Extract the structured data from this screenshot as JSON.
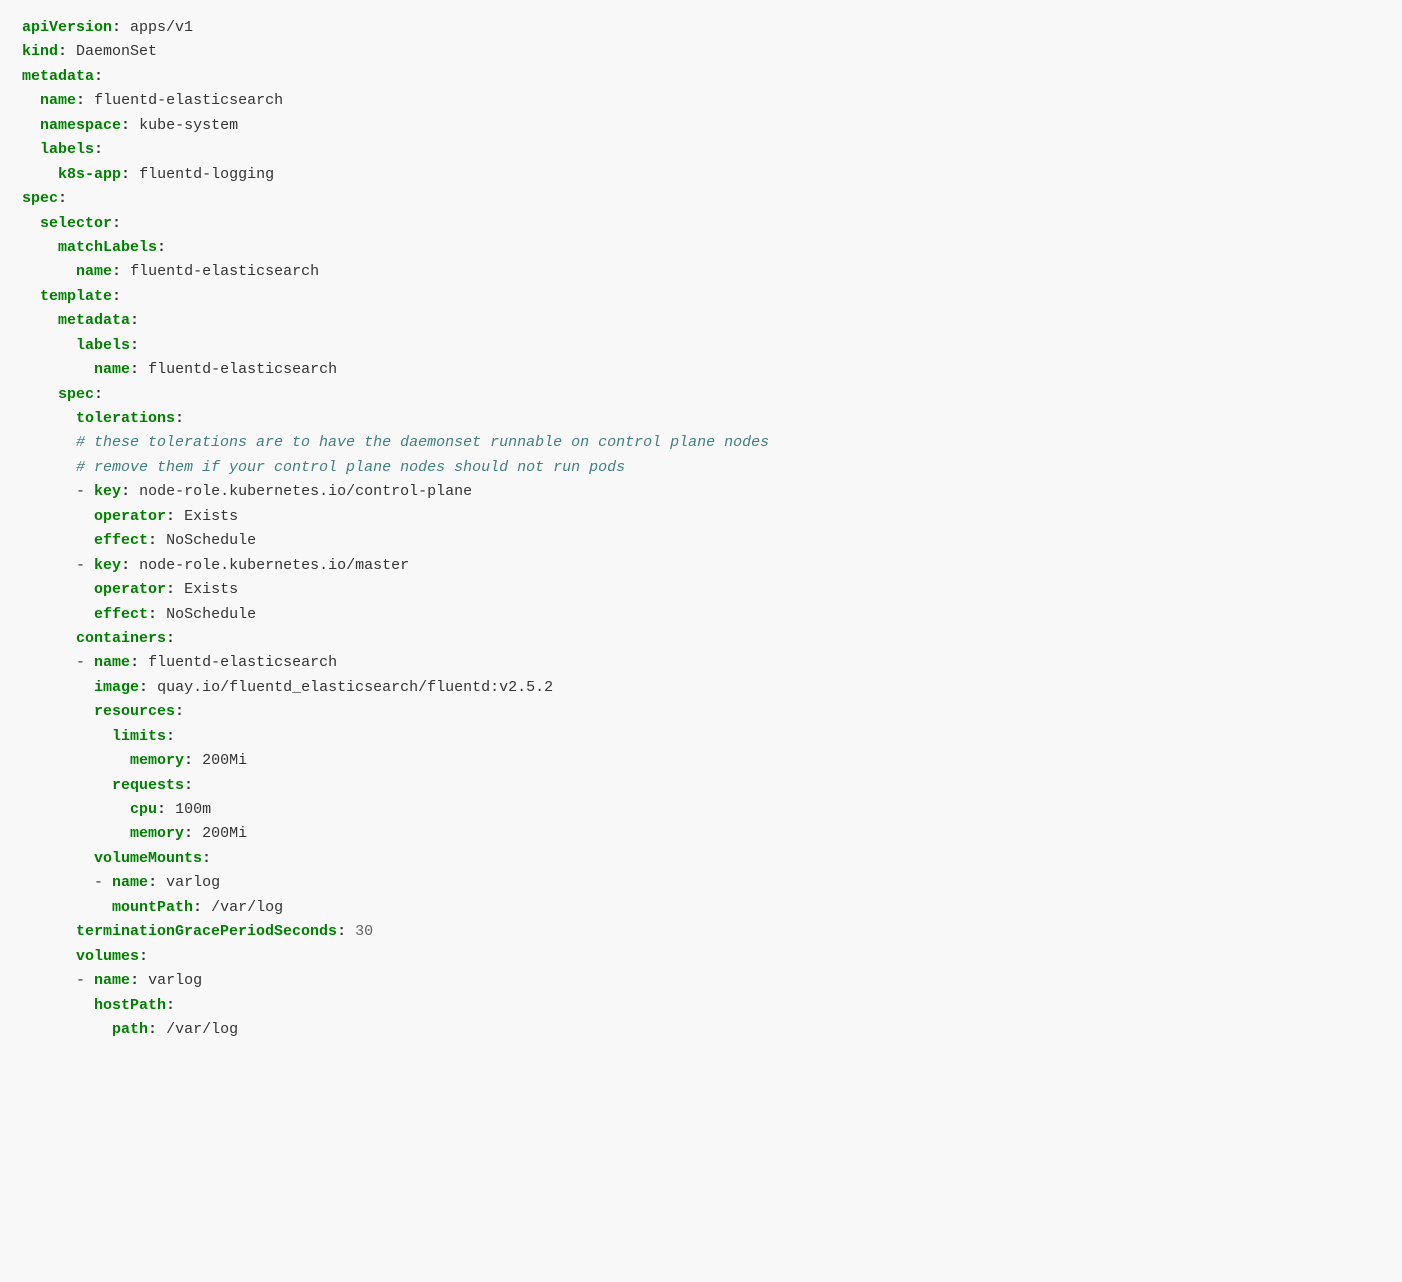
{
  "yaml": {
    "apiVersion": {
      "key": "apiVersion",
      "value": "apps/v1"
    },
    "kind": {
      "key": "kind",
      "value": "DaemonSet"
    },
    "metadata": {
      "key": "metadata",
      "name": {
        "key": "name",
        "value": "fluentd-elasticsearch"
      },
      "namespace": {
        "key": "namespace",
        "value": "kube-system"
      },
      "labels": {
        "key": "labels",
        "k8s_app": {
          "key": "k8s-app",
          "value": "fluentd-logging"
        }
      }
    },
    "spec": {
      "key": "spec",
      "selector": {
        "key": "selector",
        "matchLabels": {
          "key": "matchLabels",
          "name": {
            "key": "name",
            "value": "fluentd-elasticsearch"
          }
        }
      },
      "template": {
        "key": "template",
        "metadata": {
          "key": "metadata",
          "labels": {
            "key": "labels",
            "name": {
              "key": "name",
              "value": "fluentd-elasticsearch"
            }
          }
        },
        "spec": {
          "key": "spec",
          "tolerations": {
            "key": "tolerations",
            "comment1": "# these tolerations are to have the daemonset runnable on control plane nodes",
            "comment2": "# remove them if your control plane nodes should not run pods",
            "items": [
              {
                "key": {
                  "key": "key",
                  "value": "node-role.kubernetes.io/control-plane"
                },
                "operator": {
                  "key": "operator",
                  "value": "Exists"
                },
                "effect": {
                  "key": "effect",
                  "value": "NoSchedule"
                }
              },
              {
                "key": {
                  "key": "key",
                  "value": "node-role.kubernetes.io/master"
                },
                "operator": {
                  "key": "operator",
                  "value": "Exists"
                },
                "effect": {
                  "key": "effect",
                  "value": "NoSchedule"
                }
              }
            ]
          },
          "containers": {
            "key": "containers",
            "items": [
              {
                "name": {
                  "key": "name",
                  "value": "fluentd-elasticsearch"
                },
                "image": {
                  "key": "image",
                  "value": "quay.io/fluentd_elasticsearch/fluentd:v2.5.2"
                },
                "resources": {
                  "key": "resources",
                  "limits": {
                    "key": "limits",
                    "memory": {
                      "key": "memory",
                      "value": "200Mi"
                    }
                  },
                  "requests": {
                    "key": "requests",
                    "cpu": {
                      "key": "cpu",
                      "value": "100m"
                    },
                    "memory": {
                      "key": "memory",
                      "value": "200Mi"
                    }
                  }
                },
                "volumeMounts": {
                  "key": "volumeMounts",
                  "items": [
                    {
                      "name": {
                        "key": "name",
                        "value": "varlog"
                      },
                      "mountPath": {
                        "key": "mountPath",
                        "value": "/var/log"
                      }
                    }
                  ]
                }
              }
            ]
          },
          "terminationGracePeriodSeconds": {
            "key": "terminationGracePeriodSeconds",
            "value": "30"
          },
          "volumes": {
            "key": "volumes",
            "items": [
              {
                "name": {
                  "key": "name",
                  "value": "varlog"
                },
                "hostPath": {
                  "key": "hostPath",
                  "path": {
                    "key": "path",
                    "value": "/var/log"
                  }
                }
              }
            ]
          }
        }
      }
    }
  }
}
